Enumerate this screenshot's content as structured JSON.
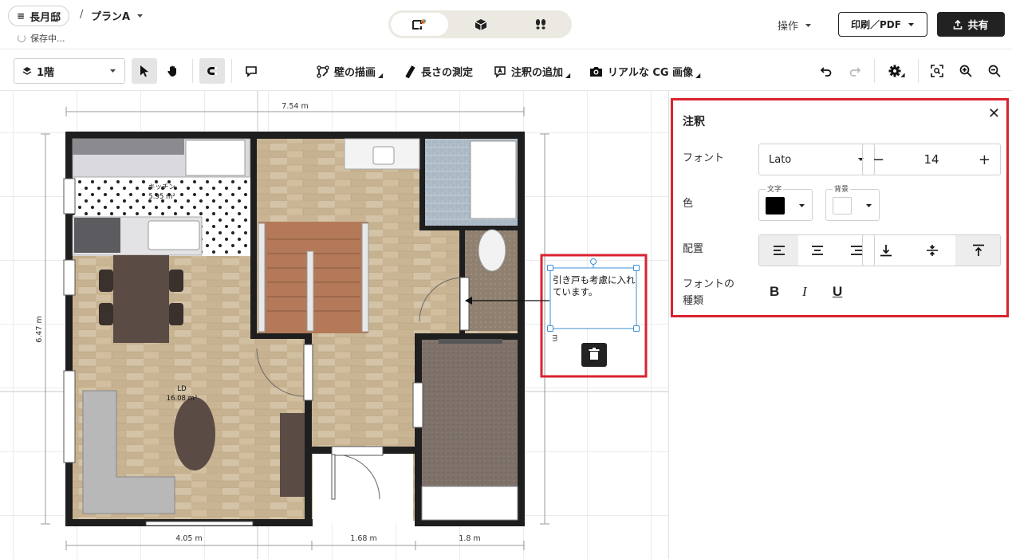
{
  "header": {
    "project_name": "長月邸",
    "breadcrumb_sep": "/",
    "plan_name": "プランA",
    "saving_status": "保存中...",
    "operations_label": "操作",
    "print_label": "印刷／PDF",
    "share_label": "共有"
  },
  "toolbar": {
    "floor_label": "1階",
    "draw_walls": "壁の描画",
    "measure": "長さの測定",
    "add_annotation": "注釈の追加",
    "cg_image": "リアルな CG 画像"
  },
  "plan": {
    "dim_top": "7.54 m",
    "dim_left": "6.47 m",
    "dim_bottom_1": "4.05 m",
    "dim_bottom_2": "1.68 m",
    "dim_bottom_3": "1.8 m",
    "kitchen_name": "キッチン",
    "kitchen_area": "5.95 m²",
    "ld_name": "LD",
    "ld_area": "16.08 m²",
    "note_text": "引き戸も考慮に入れています。",
    "note_dim_label": "m"
  },
  "panel": {
    "title": "注釈",
    "font_label": "フォント",
    "font_value": "Lato",
    "size_value": "14",
    "minus": "−",
    "plus": "+",
    "color_label": "色",
    "text_color_caption": "文字",
    "bg_color_caption": "背景",
    "text_color": "#000000",
    "bg_color": "#ffffff",
    "align_label": "配置",
    "font_style_label_1": "フォントの",
    "font_style_label_2": "種類",
    "bold": "B",
    "italic": "I",
    "underline": "U"
  },
  "colors": {
    "highlight": "#d9232f",
    "selection": "#3b8fd6",
    "wall": "#1e1e1e"
  }
}
